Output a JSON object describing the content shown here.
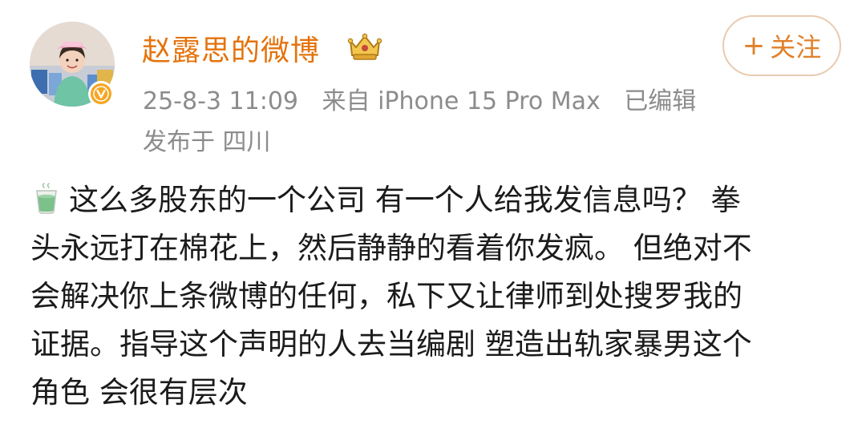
{
  "profile": {
    "username": "赵露思的微博",
    "avatar_icon": "avatar-photo",
    "verified_icon": "verified-v-icon",
    "member_icon": "crown-icon"
  },
  "meta": {
    "time": "25-8-3 11:09",
    "source": "来自 iPhone 15 Pro Max",
    "edited": "已编辑",
    "location": "发布于 四川"
  },
  "follow": {
    "plus": "+",
    "label": "关注"
  },
  "post": {
    "emoji_icon": "tea-cup-icon",
    "lines": [
      "这么多股东的一个公司 有一个人给我发信息吗？ 拳",
      "头永远打在棉花上，然后静静的看着你发疯。 但绝对不",
      "会解决你上条微博的任何，私下又让律师到处搜罗我的",
      "证据。指导这个声明的人去当编剧 塑造出轨家暴男这个",
      "角色 会很有层次"
    ]
  },
  "colors": {
    "username": "#e4730c",
    "meta": "#8c8c8c",
    "follow_border": "#e8cbb0",
    "follow_text": "#e0802a",
    "badge": "#f5a623"
  }
}
